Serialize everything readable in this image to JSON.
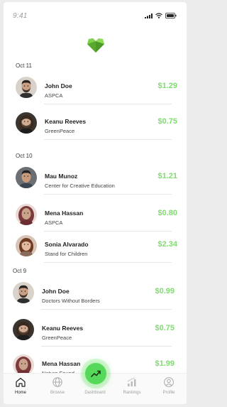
{
  "status": {
    "time": "9:41"
  },
  "groups": [
    {
      "date": "Oct 11",
      "items": [
        {
          "name": "John Doe",
          "org": "ASPCA",
          "amount": "$1.29",
          "avatar": "avatar-man-beard"
        },
        {
          "name": "Keanu Reeves",
          "org": "GreenPeace",
          "amount": "$0.75",
          "avatar": "avatar-man-long-hair"
        }
      ]
    },
    {
      "date": "Oct 10",
      "items": [
        {
          "name": "Mau Munoz",
          "org": "Center for Creative Education",
          "amount": "$1.21",
          "avatar": "avatar-man-short-hair"
        },
        {
          "name": "Mena Hassan",
          "org": "ASPCA",
          "amount": "$0.80",
          "avatar": "avatar-woman-hijab"
        },
        {
          "name": "Sonia Alvarado",
          "org": "Stand for Children",
          "amount": "$2.34",
          "avatar": "avatar-woman-long-hair"
        }
      ]
    },
    {
      "date": "Oct 9",
      "items": [
        {
          "name": "John Doe",
          "org": "Doctors Without Borders",
          "amount": "$0.99",
          "avatar": "avatar-man-beard"
        },
        {
          "name": "Keanu Reeves",
          "org": "GreenPeace",
          "amount": "$0.75",
          "avatar": "avatar-man-long-hair"
        },
        {
          "name": "Mena Hassan",
          "org": "Nature Found",
          "amount": "$1.99",
          "avatar": "avatar-woman-hijab"
        }
      ]
    }
  ],
  "tabs": [
    {
      "label": "Home",
      "icon": "home-icon",
      "active": true
    },
    {
      "label": "Browse",
      "icon": "globe-icon",
      "active": false
    },
    {
      "label": "Dashboard",
      "icon": "trend-up-icon",
      "active": false
    },
    {
      "label": "Rankings",
      "icon": "chart-icon",
      "active": false
    },
    {
      "label": "Profile",
      "icon": "user-icon",
      "active": false
    }
  ],
  "colors": {
    "accent": "#7fdc6e",
    "fab": "#56d95a",
    "logo": "#6abf3a"
  }
}
